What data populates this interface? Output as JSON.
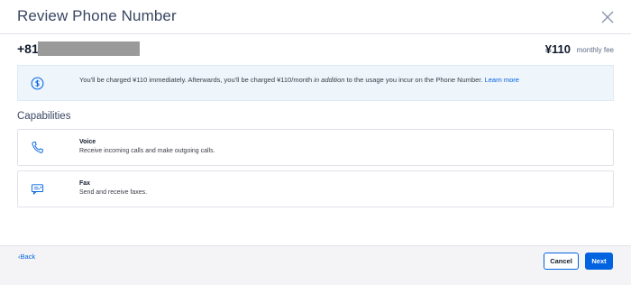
{
  "modal": {
    "title": "Review Phone Number"
  },
  "number": {
    "country_code": "+81",
    "fee_amount": "¥110",
    "fee_label": "monthly fee"
  },
  "notice": {
    "text_before": "You'll be charged ¥110 immediately. Afterwards, you'll be charged  ¥110/month ",
    "text_emphasis": "in addition",
    "text_after": " to the usage you incur on the Phone Number. ",
    "link": "Learn more",
    "icon": "dollar-circle-icon"
  },
  "capabilities": {
    "heading": "Capabilities",
    "items": [
      {
        "name": "Voice",
        "description": "Receive incoming calls and make outgoing calls.",
        "icon": "phone-icon"
      },
      {
        "name": "Fax",
        "description": "Send and receive faxes.",
        "icon": "fax-icon"
      }
    ]
  },
  "footer": {
    "back_label": "Back",
    "cancel_label": "Cancel",
    "next_label": "Next"
  },
  "colors": {
    "primary": "#0263e0",
    "notice_bg": "#eef5fb",
    "footer_bg": "#f4f4f6",
    "redaction": "#9a9a9a"
  }
}
